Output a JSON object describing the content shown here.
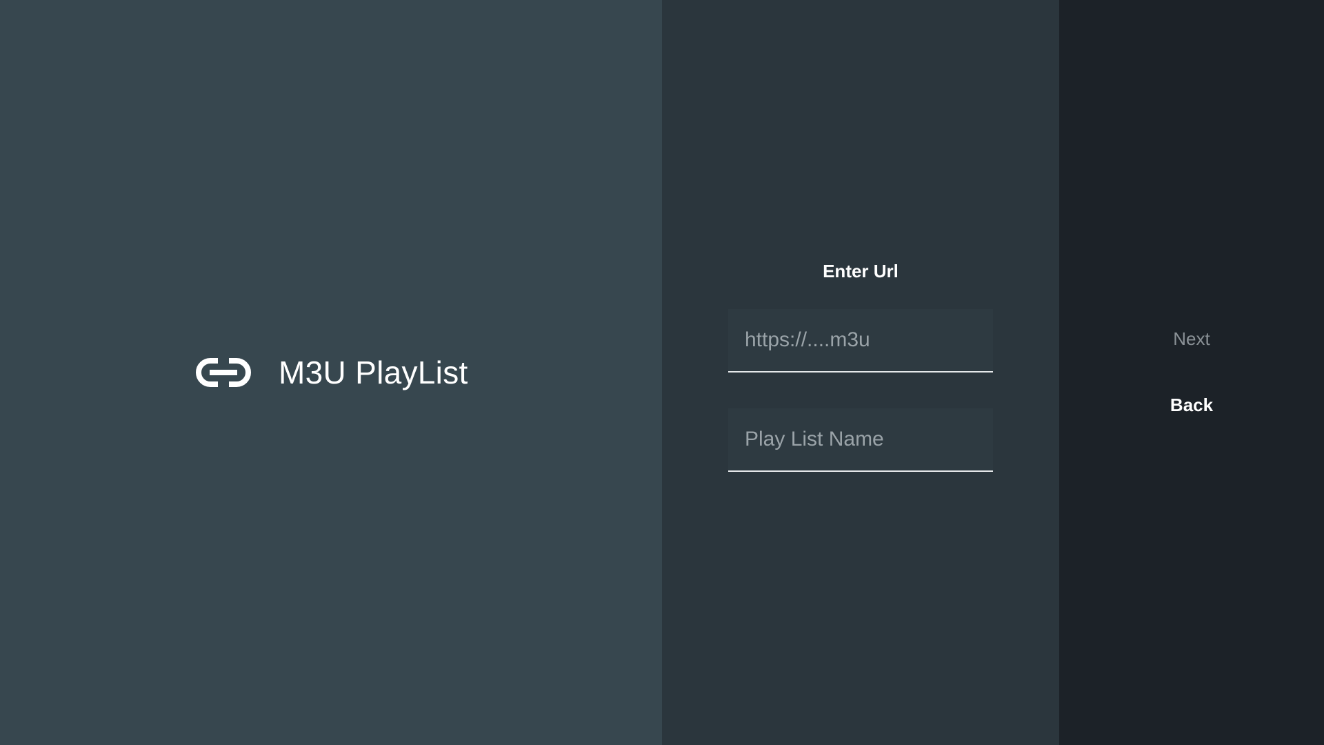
{
  "left_panel": {
    "icon": "link-icon",
    "title": "M3U PlayList"
  },
  "form": {
    "heading": "Enter Url",
    "url_field": {
      "value": "",
      "placeholder": "https://....m3u"
    },
    "name_field": {
      "value": "",
      "placeholder": "Play List Name"
    }
  },
  "actions": {
    "next_label": "Next",
    "back_label": "Back"
  },
  "colors": {
    "left_panel_bg": "#37474f",
    "middle_panel_bg": "#2b363d",
    "right_panel_bg": "#1c2228",
    "text_primary": "#ffffff",
    "text_disabled": "#8a9196"
  }
}
